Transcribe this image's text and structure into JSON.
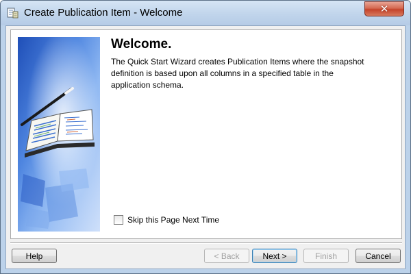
{
  "window": {
    "title": "Create Publication Item - Welcome",
    "icon": "publication-item-icon",
    "close_glyph": "✕"
  },
  "content": {
    "heading": "Welcome.",
    "description": "The Quick Start Wizard creates Publication Items where the snapshot definition is based upon all columns in a specified table in the application schema.",
    "side_image": "wizard-book-illustration",
    "skip_checkbox": {
      "label": "Skip this Page Next Time",
      "checked": false
    }
  },
  "buttons": {
    "help": "Help",
    "back": "< Back",
    "next": "Next >",
    "finish": "Finish",
    "cancel": "Cancel"
  },
  "colors": {
    "title_bar": "#c2d6ec",
    "close_button": "#c4432a",
    "panel_background": "#f0f0f0",
    "side_image_blue": "#3a6fd0"
  }
}
